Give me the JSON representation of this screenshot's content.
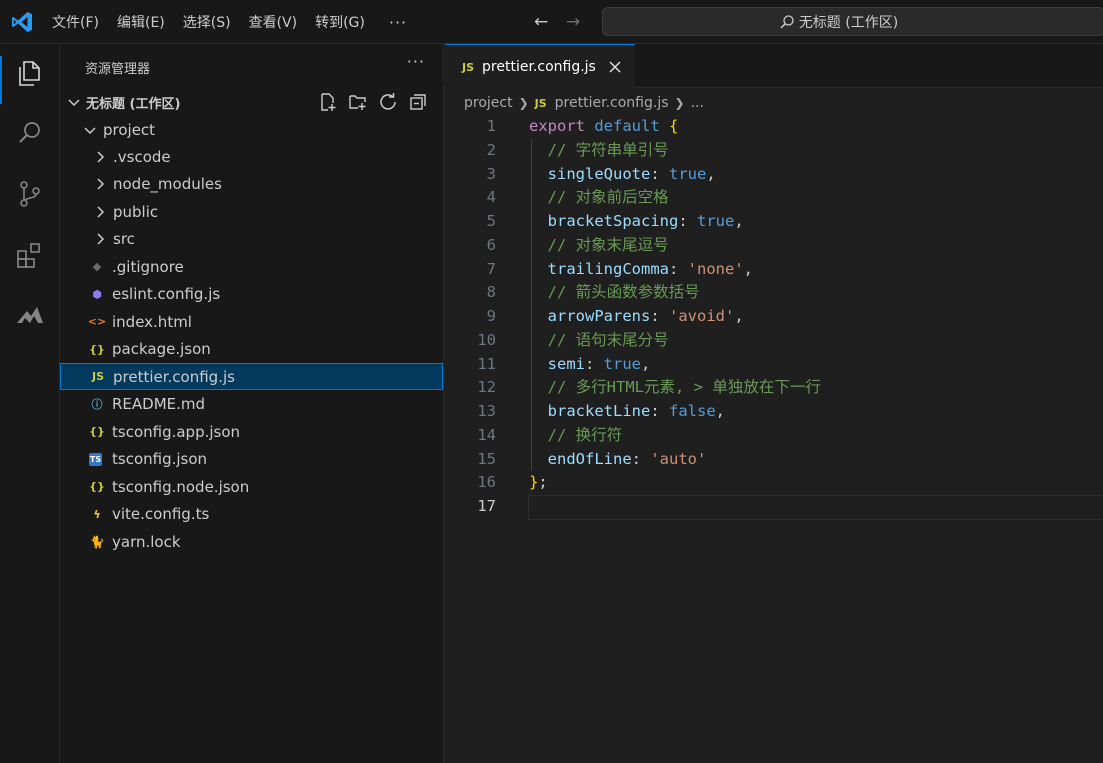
{
  "titlebar": {
    "menus": [
      "文件(F)",
      "编辑(E)",
      "选择(S)",
      "查看(V)",
      "转到(G)"
    ],
    "more": "···",
    "command_center": "无标题 (工作区)"
  },
  "activity": {
    "items": [
      "explorer-icon",
      "search-icon",
      "source-control-icon",
      "extensions-icon",
      "remote-icon"
    ]
  },
  "sidebar": {
    "title": "资源管理器",
    "more": "···",
    "workspace": "无标题 (工作区)",
    "project": "project",
    "items": [
      {
        "label": ".vscode",
        "type": "folder"
      },
      {
        "label": "node_modules",
        "type": "folder"
      },
      {
        "label": "public",
        "type": "folder"
      },
      {
        "label": "src",
        "type": "folder"
      },
      {
        "label": ".gitignore",
        "type": "git"
      },
      {
        "label": "eslint.config.js",
        "type": "eslint"
      },
      {
        "label": "index.html",
        "type": "html"
      },
      {
        "label": "package.json",
        "type": "json"
      },
      {
        "label": "prettier.config.js",
        "type": "js",
        "selected": true
      },
      {
        "label": "README.md",
        "type": "info"
      },
      {
        "label": "tsconfig.app.json",
        "type": "json"
      },
      {
        "label": "tsconfig.json",
        "type": "ts"
      },
      {
        "label": "tsconfig.node.json",
        "type": "json"
      },
      {
        "label": "vite.config.ts",
        "type": "vite"
      },
      {
        "label": "yarn.lock",
        "type": "yarn"
      }
    ]
  },
  "editor": {
    "tab": {
      "badge": "JS",
      "label": "prettier.config.js"
    },
    "breadcrumb": {
      "folder": "project",
      "badge": "JS",
      "file": "prettier.config.js",
      "more": "..."
    },
    "active_line": 17,
    "lines": [
      [
        [
          "kw",
          "export"
        ],
        [
          "punc",
          " "
        ],
        [
          "def",
          "default"
        ],
        [
          "punc",
          " "
        ],
        [
          "brace",
          "{"
        ]
      ],
      [
        [
          "punc",
          "  "
        ],
        [
          "cm",
          "// 字符串单引号"
        ]
      ],
      [
        [
          "punc",
          "  "
        ],
        [
          "prop",
          "singleQuote"
        ],
        [
          "punc",
          ": "
        ],
        [
          "bool",
          "true"
        ],
        [
          "punc",
          ","
        ]
      ],
      [
        [
          "punc",
          "  "
        ],
        [
          "cm",
          "// 对象前后空格"
        ]
      ],
      [
        [
          "punc",
          "  "
        ],
        [
          "prop",
          "bracketSpacing"
        ],
        [
          "punc",
          ": "
        ],
        [
          "bool",
          "true"
        ],
        [
          "punc",
          ","
        ]
      ],
      [
        [
          "punc",
          "  "
        ],
        [
          "cm",
          "// 对象末尾逗号"
        ]
      ],
      [
        [
          "punc",
          "  "
        ],
        [
          "prop",
          "trailingComma"
        ],
        [
          "punc",
          ": "
        ],
        [
          "str",
          "'none'"
        ],
        [
          "punc",
          ","
        ]
      ],
      [
        [
          "punc",
          "  "
        ],
        [
          "cm",
          "// 箭头函数参数括号"
        ]
      ],
      [
        [
          "punc",
          "  "
        ],
        [
          "prop",
          "arrowParens"
        ],
        [
          "punc",
          ": "
        ],
        [
          "str",
          "'avoid'"
        ],
        [
          "punc",
          ","
        ]
      ],
      [
        [
          "punc",
          "  "
        ],
        [
          "cm",
          "// 语句末尾分号"
        ]
      ],
      [
        [
          "punc",
          "  "
        ],
        [
          "prop",
          "semi"
        ],
        [
          "punc",
          ": "
        ],
        [
          "bool",
          "true"
        ],
        [
          "punc",
          ","
        ]
      ],
      [
        [
          "punc",
          "  "
        ],
        [
          "cm",
          "// 多行HTML元素, > 单独放在下一行"
        ]
      ],
      [
        [
          "punc",
          "  "
        ],
        [
          "prop",
          "bracketLine"
        ],
        [
          "punc",
          ": "
        ],
        [
          "bool",
          "false"
        ],
        [
          "punc",
          ","
        ]
      ],
      [
        [
          "punc",
          "  "
        ],
        [
          "cm",
          "// 换行符"
        ]
      ],
      [
        [
          "punc",
          "  "
        ],
        [
          "prop",
          "endOfLine"
        ],
        [
          "punc",
          ": "
        ],
        [
          "str",
          "'auto'"
        ]
      ],
      [
        [
          "brace",
          "}"
        ],
        [
          "punc",
          ";"
        ]
      ],
      []
    ]
  }
}
